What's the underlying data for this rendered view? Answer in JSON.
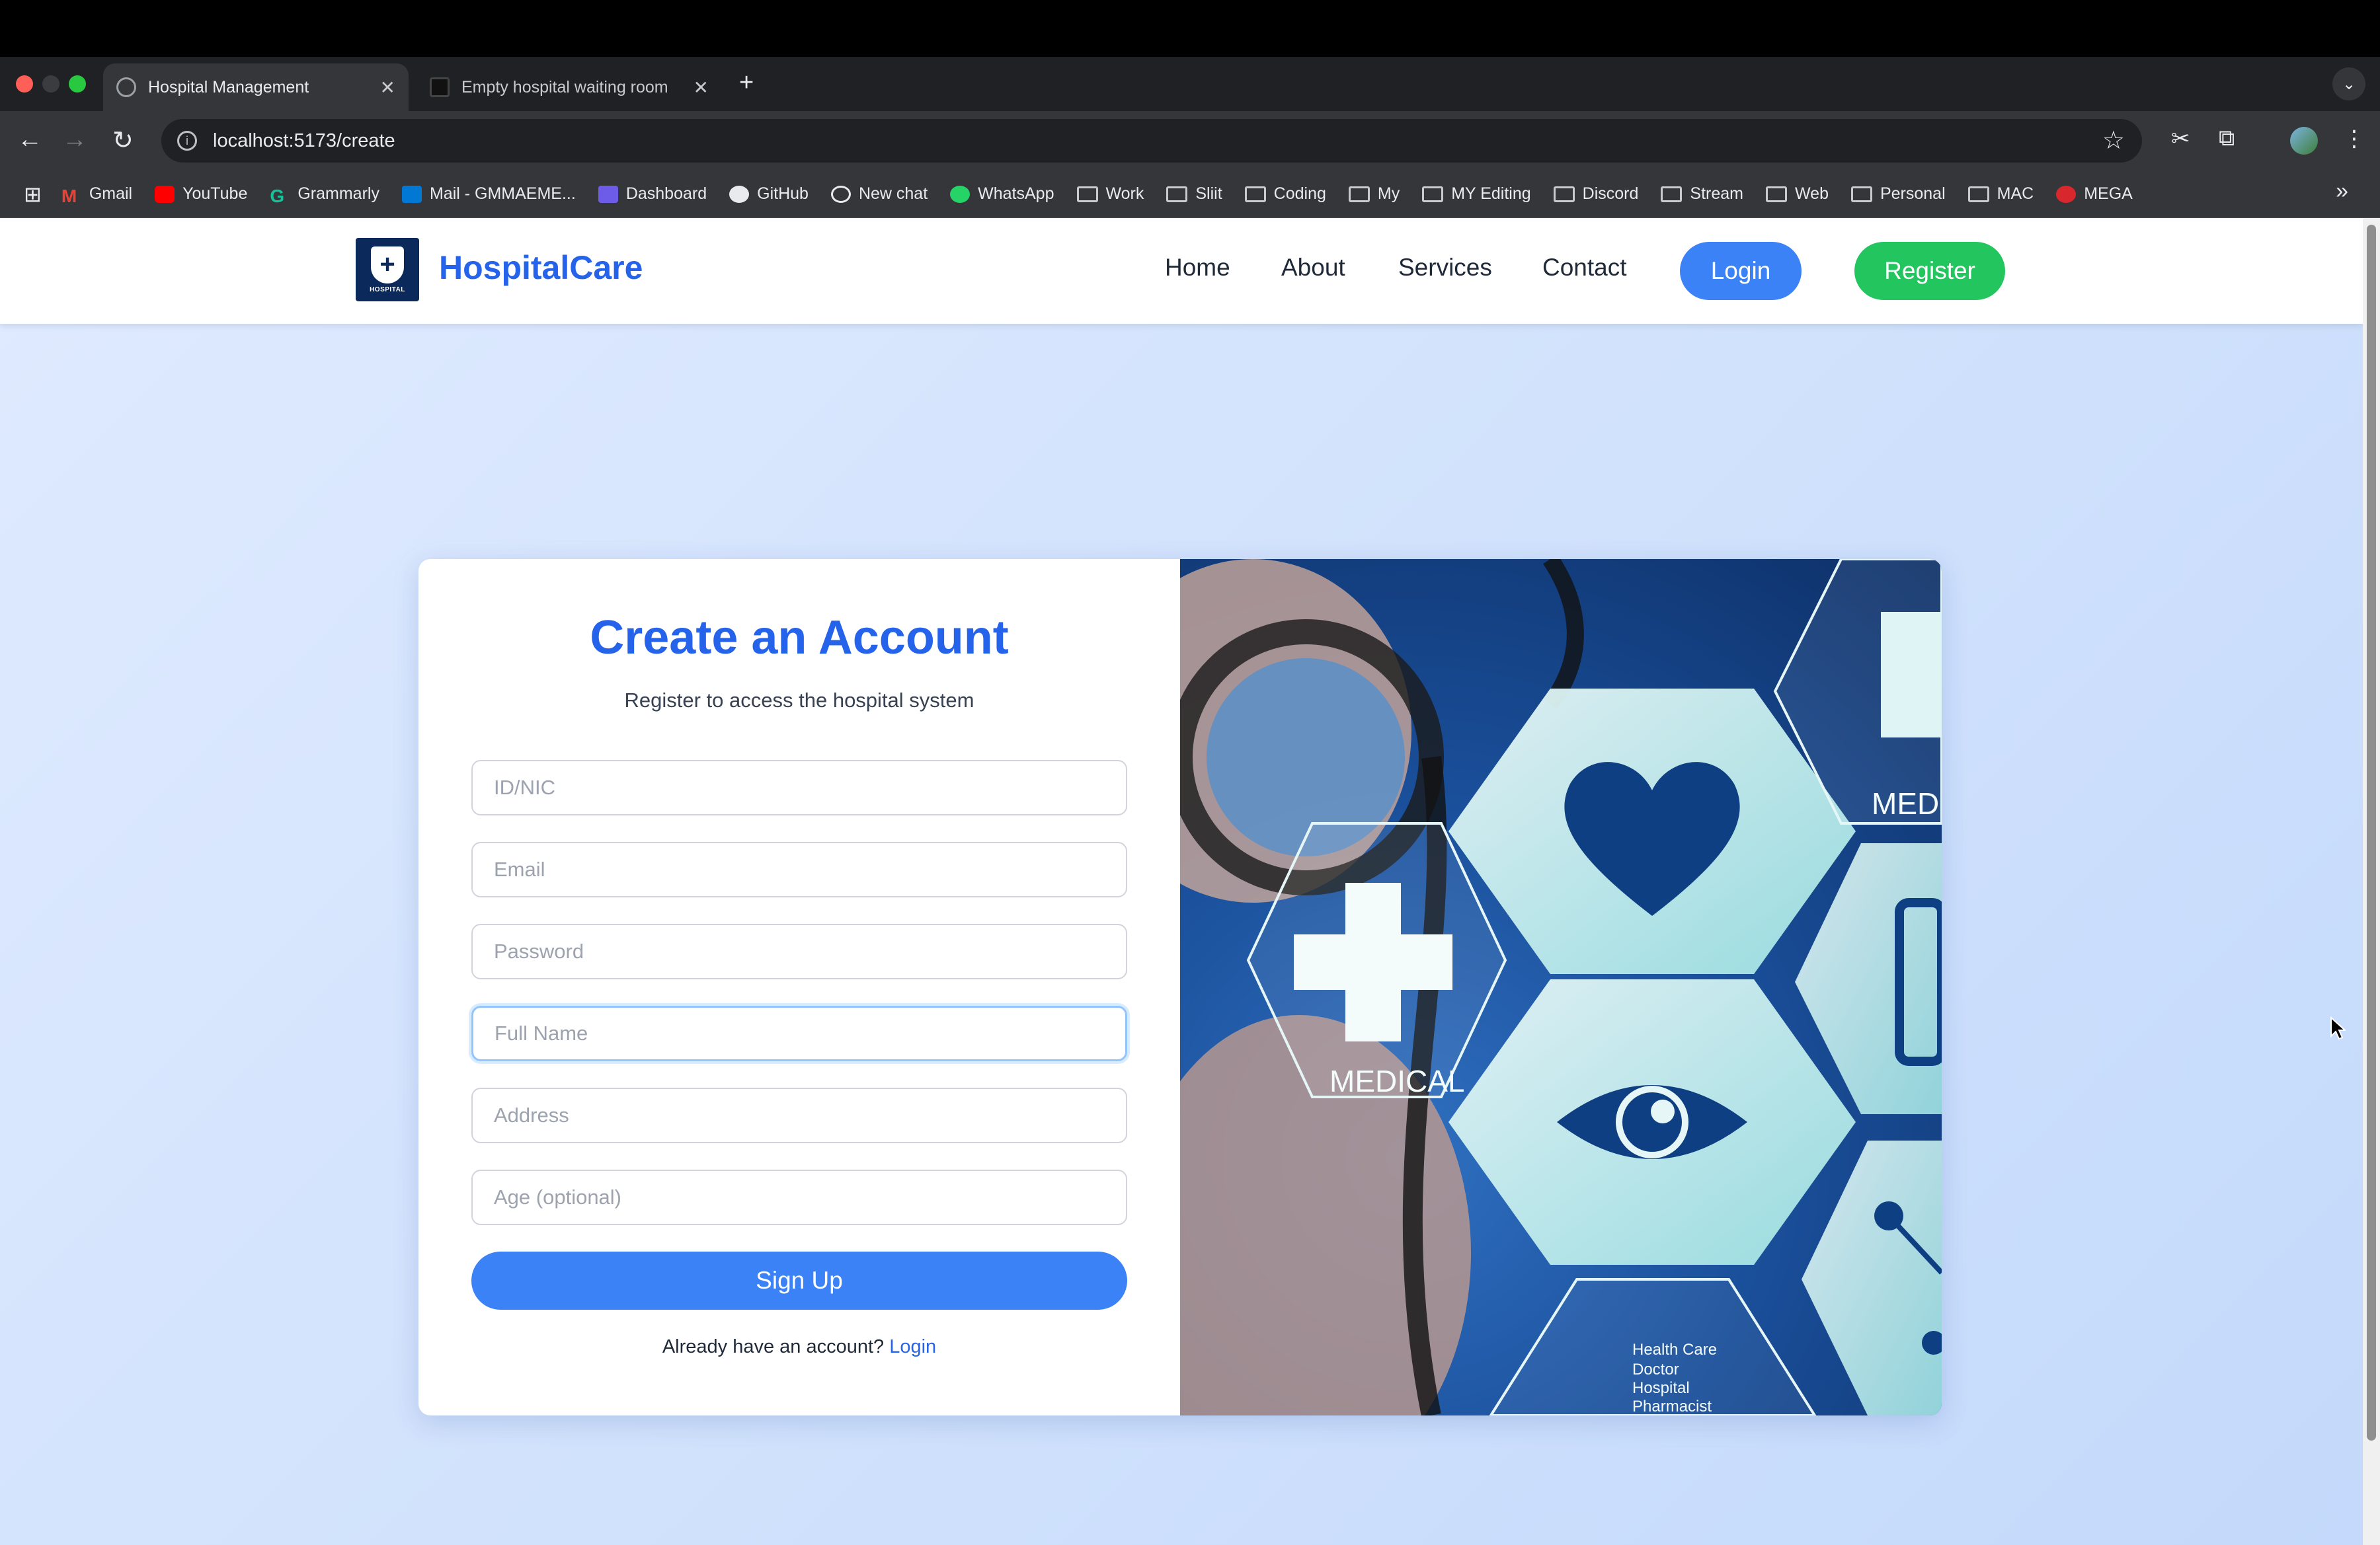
{
  "browser": {
    "tabs": [
      {
        "title": "Hospital Management",
        "active": true
      },
      {
        "title": "Empty hospital waiting room",
        "active": false
      }
    ],
    "url": "localhost:5173/create",
    "bookmarks": [
      {
        "label": "Gmail",
        "icon": "gmail-icon"
      },
      {
        "label": "YouTube",
        "icon": "youtube-icon"
      },
      {
        "label": "Grammarly",
        "icon": "grammarly-icon"
      },
      {
        "label": "Mail - GMMAEME...",
        "icon": "outlook-icon"
      },
      {
        "label": "Dashboard",
        "icon": "dashboard-icon"
      },
      {
        "label": "GitHub",
        "icon": "github-icon"
      },
      {
        "label": "New chat",
        "icon": "chatgpt-icon"
      },
      {
        "label": "WhatsApp",
        "icon": "whatsapp-icon"
      },
      {
        "label": "Work",
        "icon": "folder-icon"
      },
      {
        "label": "Sliit",
        "icon": "folder-icon"
      },
      {
        "label": "Coding",
        "icon": "folder-icon"
      },
      {
        "label": "My",
        "icon": "folder-icon"
      },
      {
        "label": "MY Editing",
        "icon": "folder-icon"
      },
      {
        "label": "Discord",
        "icon": "folder-icon"
      },
      {
        "label": "Stream",
        "icon": "folder-icon"
      },
      {
        "label": "Web",
        "icon": "folder-icon"
      },
      {
        "label": "Personal",
        "icon": "folder-icon"
      },
      {
        "label": "MAC",
        "icon": "folder-icon"
      },
      {
        "label": "MEGA",
        "icon": "mega-icon"
      }
    ]
  },
  "navbar": {
    "logo_text": "HOSPITAL",
    "brand": "HospitalCare",
    "links": [
      "Home",
      "About",
      "Services",
      "Contact"
    ],
    "login_label": "Login",
    "register_label": "Register"
  },
  "form": {
    "title": "Create an Account",
    "subtitle": "Register to access the hospital system",
    "fields": [
      {
        "placeholder": "ID/NIC",
        "value": ""
      },
      {
        "placeholder": "Email",
        "value": ""
      },
      {
        "placeholder": "Password",
        "value": ""
      },
      {
        "placeholder": "Full Name",
        "value": ""
      },
      {
        "placeholder": "Address",
        "value": ""
      },
      {
        "placeholder": "Age (optional)",
        "value": ""
      }
    ],
    "submit_label": "Sign Up",
    "footer_text": "Already have an account?",
    "footer_link": "Login"
  },
  "hero_image": {
    "labels": [
      "MEDICAL",
      "MED"
    ],
    "caption_lines": [
      "Health Care",
      "Doctor",
      "Hospital",
      "Pharmacist"
    ]
  },
  "colors": {
    "primary": "#3b82f6",
    "brand_text": "#2563eb",
    "register": "#22c55e"
  }
}
